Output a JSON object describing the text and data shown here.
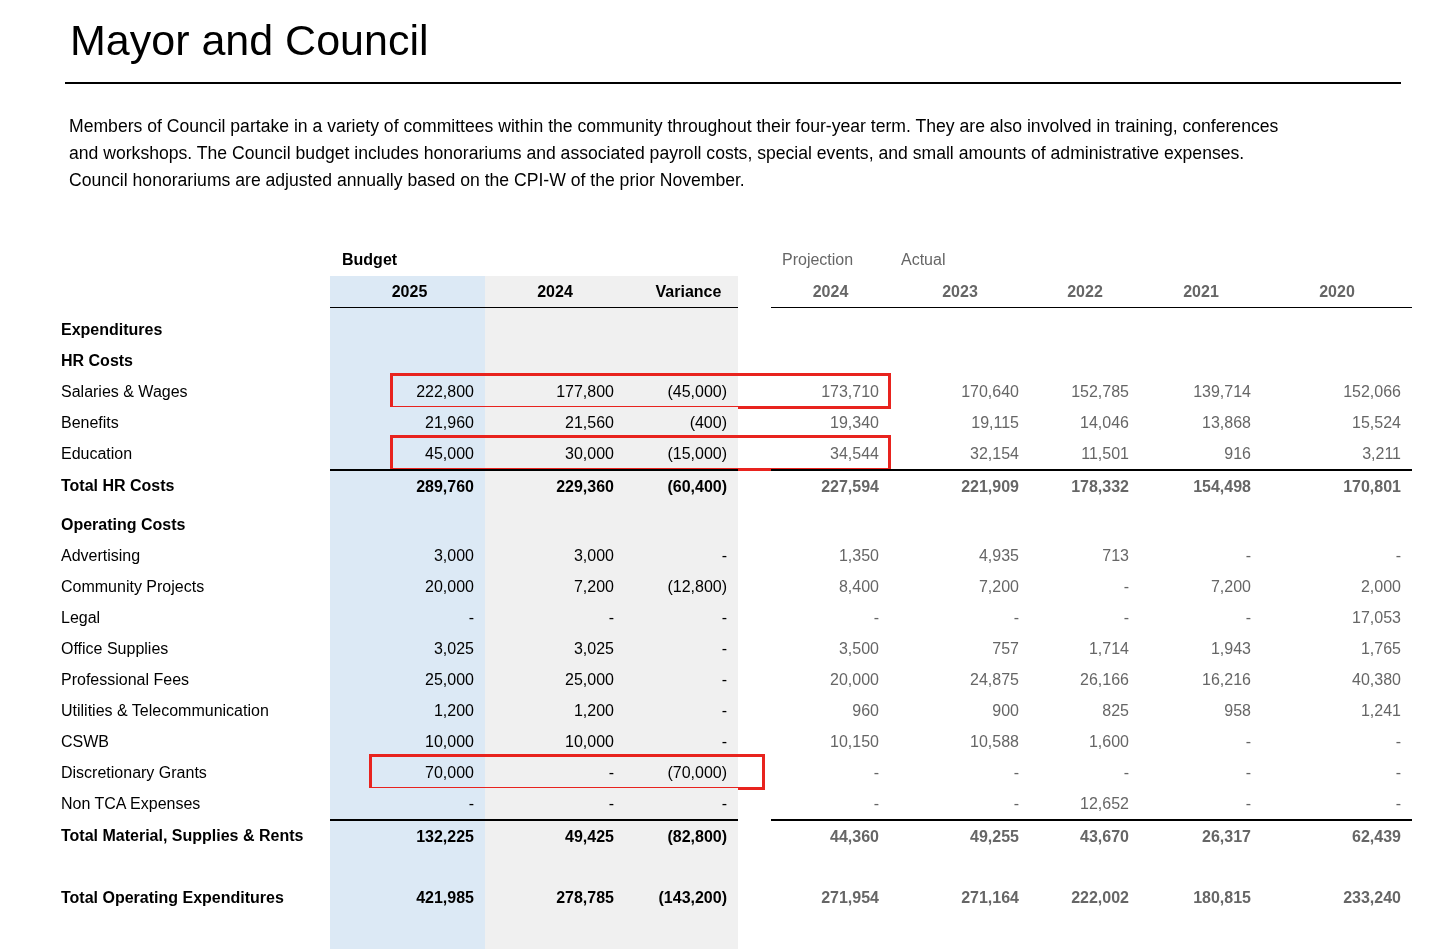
{
  "title": "Mayor and Council",
  "description": "Members of Council partake in a variety of committees within the community throughout their four-year term. They are also involved in training, conferences and workshops. The Council budget includes honorariums and associated payroll costs, special events, and small amounts of administrative expenses. Council honorariums are adjusted annually based on the CPI-W of the prior November.",
  "table": {
    "columns": [
      {
        "label": "2025",
        "group_label": "Budget",
        "kind": "budget_current"
      },
      {
        "label": "2024",
        "kind": "budget"
      },
      {
        "label": "Variance",
        "kind": "budget"
      },
      {
        "label": "2024",
        "group_label": "Projection",
        "kind": "history"
      },
      {
        "label": "2023",
        "group_label": "Actual",
        "kind": "history"
      },
      {
        "label": "2022",
        "kind": "history"
      },
      {
        "label": "2021",
        "kind": "history"
      },
      {
        "label": "2020",
        "kind": "history"
      }
    ],
    "rows": [
      {
        "label": "Expenditures",
        "kind": "heading"
      },
      {
        "label": "HR Costs",
        "kind": "heading"
      },
      {
        "label": "Salaries & Wages",
        "kind": "item",
        "highlighted": true,
        "highlight_includes_projection": true,
        "values": [
          "222,800",
          "177,800",
          "(45,000)",
          "173,710",
          "170,640",
          "152,785",
          "139,714",
          "152,066"
        ]
      },
      {
        "label": "Benefits",
        "kind": "item",
        "values": [
          "21,960",
          "21,560",
          "(400)",
          "19,340",
          "19,115",
          "14,046",
          "13,868",
          "15,524"
        ]
      },
      {
        "label": "Education",
        "kind": "item",
        "highlighted": true,
        "highlight_includes_projection": true,
        "values": [
          "45,000",
          "30,000",
          "(15,000)",
          "34,544",
          "32,154",
          "11,501",
          "916",
          "3,211"
        ]
      },
      {
        "label": "Total HR Costs",
        "kind": "subtotal",
        "values": [
          "289,760",
          "229,360",
          "(60,400)",
          "227,594",
          "221,909",
          "178,332",
          "154,498",
          "170,801"
        ]
      },
      {
        "label": "Operating Costs",
        "kind": "heading"
      },
      {
        "label": "Advertising",
        "kind": "item",
        "values": [
          "3,000",
          "3,000",
          "-",
          "1,350",
          "4,935",
          "713",
          "-",
          "-"
        ]
      },
      {
        "label": "Community Projects",
        "kind": "item",
        "values": [
          "20,000",
          "7,200",
          "(12,800)",
          "8,400",
          "7,200",
          "-",
          "7,200",
          "2,000"
        ]
      },
      {
        "label": "Legal",
        "kind": "item",
        "values": [
          "-",
          "-",
          "-",
          "-",
          "-",
          "-",
          "-",
          "17,053"
        ]
      },
      {
        "label": "Office Supplies",
        "kind": "item",
        "values": [
          "3,025",
          "3,025",
          "-",
          "3,500",
          "757",
          "1,714",
          "1,943",
          "1,765"
        ]
      },
      {
        "label": "Professional Fees",
        "kind": "item",
        "values": [
          "25,000",
          "25,000",
          "-",
          "20,000",
          "24,875",
          "26,166",
          "16,216",
          "40,380"
        ]
      },
      {
        "label": "Utilities & Telecommunication",
        "kind": "item",
        "values": [
          "1,200",
          "1,200",
          "-",
          "960",
          "900",
          "825",
          "958",
          "1,241"
        ]
      },
      {
        "label": "CSWB",
        "kind": "item",
        "values": [
          "10,000",
          "10,000",
          "-",
          "10,150",
          "10,588",
          "1,600",
          "-",
          "-"
        ]
      },
      {
        "label": "Discretionary Grants",
        "kind": "item",
        "highlighted": true,
        "highlight_includes_projection": false,
        "values": [
          "70,000",
          "-",
          "(70,000)",
          "-",
          "-",
          "-",
          "-",
          "-"
        ]
      },
      {
        "label": "Non TCA Expenses",
        "kind": "item",
        "values": [
          "-",
          "-",
          "-",
          "-",
          "-",
          "12,652",
          "-",
          "-"
        ]
      },
      {
        "label": "Total Material, Supplies & Rents",
        "kind": "subtotal",
        "values": [
          "132,225",
          "49,425",
          "(82,800)",
          "44,360",
          "49,255",
          "43,670",
          "26,317",
          "62,439"
        ]
      },
      {
        "label": "Total Operating Expenditures",
        "kind": "grand_total",
        "values": [
          "421,985",
          "278,785",
          "(143,200)",
          "271,954",
          "271,164",
          "222,002",
          "180,815",
          "233,240"
        ]
      }
    ]
  }
}
